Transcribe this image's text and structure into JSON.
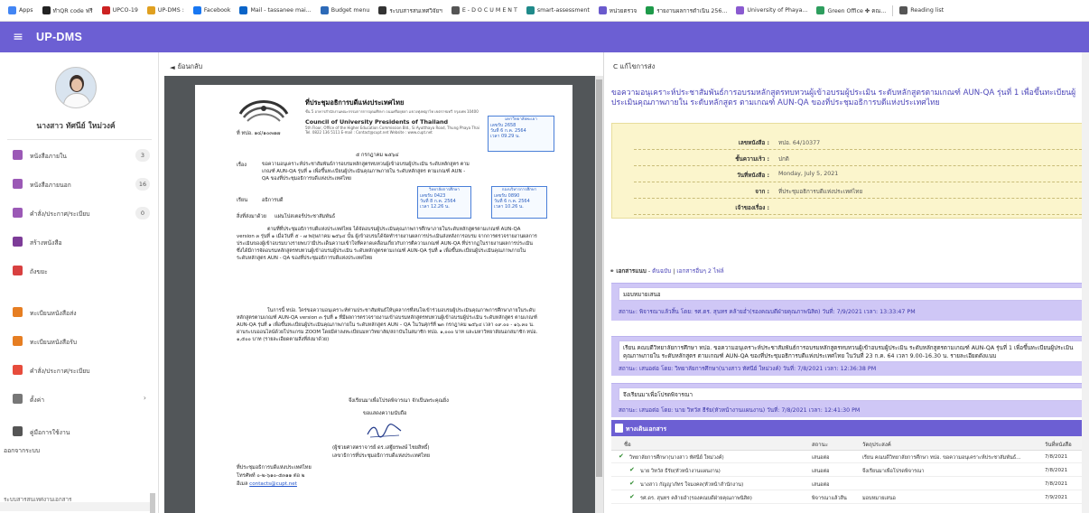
{
  "bookmarks": [
    {
      "label": "Apps",
      "color": "#4285f4"
    },
    {
      "label": "ทำQR code ฟรี",
      "color": "#222222"
    },
    {
      "label": "UPCO-19",
      "color": "#cc2222"
    },
    {
      "label": "UP-DMS : ",
      "color": "#e0a020"
    },
    {
      "label": "Facebook",
      "color": "#1877f2"
    },
    {
      "label": "Mail - tassanee mai...",
      "color": "#0a64c8"
    },
    {
      "label": "Budget menu",
      "color": "#2d6ab8"
    },
    {
      "label": "ระบบสารสนเทศวิจัยฯ",
      "color": "#333333"
    },
    {
      "label": "E - D O C U M E N T",
      "color": "#555555"
    },
    {
      "label": "smart-assessment",
      "color": "#1f8a8a"
    },
    {
      "label": "หน่วยตรวจ",
      "color": "#6a5acd"
    },
    {
      "label": "รายงานผลการดำเนิน 256...",
      "color": "#1e9a4a"
    },
    {
      "label": "University of Phaya...",
      "color": "#8a5ad0"
    },
    {
      "label": "Green Office ✤ คณ...",
      "color": "#2e9e5e"
    },
    {
      "label": "Reading list",
      "color": "#555555"
    }
  ],
  "app": {
    "title": "UP-DMS"
  },
  "user": {
    "name": "นางสาว ทัศนีย์ ใหม่วงค์"
  },
  "nav": [
    {
      "label": "หนังสือภายใน",
      "count": "3",
      "color": "#9b59b6"
    },
    {
      "label": "หนังสือภายนอก",
      "count": "16",
      "color": "#9b59b6"
    },
    {
      "label": "คำสั่ง/ประกาศ/ระเบียบ",
      "count": "0",
      "color": "#9b59b6"
    },
    {
      "label": "สร้างหนังสือ",
      "count": "",
      "color": "#7d3c98"
    },
    {
      "label": "ถังขยะ",
      "count": "",
      "color": "#d84040"
    },
    {
      "label": "ทะเบียนหนังสือส่ง",
      "count": "",
      "color": "#e67e22"
    },
    {
      "label": "ทะเบียนหนังสือรับ",
      "count": "",
      "color": "#e67e22"
    },
    {
      "label": "คำสั่ง/ประกาศ/ระเบียบ",
      "count": "",
      "color": "#e74c3c"
    },
    {
      "label": "ตั้งค่า",
      "count": "",
      "color": "#777777"
    },
    {
      "label": "คู่มือการใช้งาน",
      "count": "",
      "color": "#555555"
    },
    {
      "label": "ออกจากระบบ",
      "count": "",
      "color": ""
    }
  ],
  "sidebar_footer": "ระบบสารสนเทศงานเอกสาร",
  "doc_panel": {
    "back_label": "ย้อนกลับ"
  },
  "letter": {
    "org_th": "ที่ประชุมอธิการบดีแห่งประเทศไทย",
    "org_addr1": "ชั้น 5 อาคารสำนักงานคณะกรรมการการอุดมศึกษา ถนนศรีอยุธยา แขวงทุ่งพญาไท เขตราชเทวี กรุงเทพ 10400",
    "org_addr2": "Council of University Presidents of Thailand",
    "org_addr3": "5th Floor, Office of the Higher Education Commission Bld., Si Ayutthaya Road, Thung Phaya Thai",
    "org_addr4": "Tel. 0822 136 5111 E-mail : Contact@cupt.net  Website : www.cupt.net",
    "ref_no": "ที่ ทปอ. ๑๔/๑๐๓๗๗",
    "date": "๕ กรกฎาคม ๒๕๖๔",
    "subject_label": "เรื่อง",
    "subject": "ขอความอนุเคราะห์ประชาสัมพันธ์การอบรมหลักสูตรทบทวนผู้เข้าอบรมผู้ประเมิน ระดับหลักสูตร ตามเกณฑ์ AUN-QA รุ่นที่ ๑ เพื่อขึ้นทะเบียนผู้ประเมินคุณภาพภายใน ระดับหลักสูตร ตามเกณฑ์ AUN - QA ของที่ประชุมอธิการบดีแห่งประเทศไทย",
    "to_label": "เรียน",
    "to": "อธิการบดี",
    "enc_label": "สิ่งที่ส่งมาด้วย",
    "enc": "แผ่นโปสเตอร์ประชาสัมพันธ์",
    "para1": "ตามที่ที่ประชุมอธิการบดีแห่งประเทศไทย ได้จัดอบรมผู้ประเมินคุณภาพการศึกษาภายในระดับหลักสูตรตามเกณฑ์ AUN-QA version ๓ รุ่นที่ ๑ เมื่อวันที่ ๕ - ๗ พฤษภาคม ๒๕๖๔ นั้น ผู้เข้าอบรมได้จัดทำรายงานผลการประเมินส่งหลังการอบรม จากการตรวจรายงานผลการประเมินของผู้เข้าอบรมบางรายพบว่ามีประเด็นความเข้าใจที่คลาดเคลื่อนเกี่ยวกับการตีความเกณฑ์ AUN-QA ที่ปรากฏในรายงานผลการประเมิน ซึ่งได้มีการจัดอบรมหลักสูตรทบทวนผู้เข้าอบรมผู้ประเมิน ระดับหลักสูตรตามเกณฑ์ AUN-QA รุ่นที่ ๑ เพื่อขึ้นทะเบียนผู้ประเมินคุณภาพภายใน ระดับหลักสูตร AUN - QA ของที่ประชุมอธิการบดีแห่งประเทศไทย",
    "para2": "ในการนี้ ทปอ. ใคร่ขอความอนุเคราะห์ท่านประชาสัมพันธ์ให้บุคลากรที่สนใจเข้าร่วมอบรมผู้ประเมินคุณภาพการศึกษาภายในระดับหลักสูตรตามเกณฑ์ AUN-QA version ๓ รุ่นที่ ๑ ที่มีผลการตรวจรายงานเข้าอบรมหลักสูตรทบทวนผู้เข้าอบรมผู้ประเมิน ระดับหลักสูตร ตามเกณฑ์ AUN-QA รุ่นที่ ๑ เพื่อขึ้นทะเบียนผู้ประเมินคุณภาพภายใน ระดับหลักสูตร AUN – QA ในวันศุกร์ที่ ๒๓ กรกฎาคม ๒๕๖๔ เวลา ๐๙.๐๐ - ๑๖.๓๐ น. ผ่านระบบออนไลน์ด้วยโปรแกรม ZOOM โดยมีค่าลงทะเบียนมหาวิทยาลัย/สถาบันในสมาชิก ทปอ. ๑,๐๐๐ บาท และมหาวิทยาลัยนอกสมาชิก ทปอ. ๑,๕๐๐ บาท (รายละเอียดตามสิ่งที่ส่งมาด้วย)",
    "closing": "จึงเรียนมาเพื่อโปรดพิจารณา จักเป็นพระคุณยิ่ง",
    "regards": "ขอแสดงความนับถือ",
    "signer": "(ผู้ช่วยศาสตราจารย์ ดร.เสฐียรพงษ์ ไชยสิทธิ์)",
    "signer_title": "เลขาธิการที่ประชุมอธิการบดีแห่งประเทศไทย",
    "footer_org": "ที่ประชุมอธิการบดีแห่งประเทศไทย",
    "footer_tel": "โทรศัพท์ ๐-๒-๖๑๐-๕๓๑๑ ต่อ ๒",
    "footer_email_label": "อีเมล",
    "footer_email": "contacts@cupt.net"
  },
  "stamps": [
    {
      "h": "มหาวิทยาลัยพะเยา",
      "no": "เลขรับ 2658",
      "date": "วันที่ 6 ก.ค. 2564",
      "time": "เวลา 09.29 น."
    },
    {
      "h": "วิทยาลัยการศึกษา",
      "no": "เลขรับ 0423",
      "date": "วันที่ 8 ก.ค. 2564",
      "time": "เวลา 12.26 น."
    },
    {
      "h": "กองบริหารการศึกษา",
      "no": "เลขรับ 0890",
      "date": "วันที่ 6 ก.ค. 2564",
      "time": "เวลา 10.26 น."
    }
  ],
  "right_panel": {
    "back_label": "แก้ไขการส่ง",
    "title": "ขอความอนุเคราะห์ประชาสัมพันธ์การอบรมหลักสูตรทบทวนผู้เข้าอบรมผู้ประเมิน ระดับหลักสูตรตามเกณฑ์ AUN-QA รุ่นที่ 1 เพื่อขึ้นทะเบียนผู้ประเมินคุณภาพภายใน ระดับหลักสูตร ตามเกณฑ์ AUN-QA ของที่ประชุมอธิการบดีแห่งประเทศไทย",
    "info": [
      {
        "label": "เลขหนังสือ :",
        "value": "ทปอ. 64/10377"
      },
      {
        "label": "ชั้นความเร็ว :",
        "value": "ปกติ"
      },
      {
        "label": "วันที่หนังสือ :",
        "value": "Monday, July 5, 2021"
      },
      {
        "label": "จาก :",
        "value": "ที่ประชุมอธิการบดีแห่งประเทศไทย"
      },
      {
        "label": "เจ้าของเรื่อง :",
        "value": ""
      }
    ],
    "attachments": {
      "prefix": "เอกสารแนบ",
      "sep": "-",
      "all": "ต้นฉบับ",
      "pipe": "|",
      "files": "เอกสารอื่นๆ 2 ไฟล์"
    },
    "actions": [
      {
        "message": "มอบหมายเสนอ",
        "status": "สถานะ: พิจารณาแล้วสิ้น โดย: รศ.ดร. สุนทร คล้ายอ่ำ(รองคณบดีฝ่ายคุณภาพนิสิต)  วันที่: 7/9/2021  เวลา: 13:33:47 PM"
      },
      {
        "message": "เรียน คณบดีวิทยาลัยการศึกษา ทปอ. ขอความอนุเคราะห์ประชาสัมพันธ์การอบรมหลักสูตรทบทวนผู้เข้าอบรมผู้ประเมิน ระดับหลักสูตรตามเกณฑ์ AUN-QA รุ่นที่ 1 เพื่อขึ้นทะเบียนผู้ประเมินคุณภาพภายใน ระดับหลักสูตร ตามเกณฑ์ AUN-QA ของที่ประชุมอธิการบดีแห่งประเทศไทย ในวันที่ 23 ก.ค. 64 เวลา 9.00-16.30 น. รายละเอียดดังแนบ",
        "status": "สถานะ: เสนอต่อ  โดย: วิทยาลัยการศึกษา(นางสาว ทัศนีย์ ใหม่วงค์)  วันที่: 7/8/2021  เวลา: 12:36:38 PM"
      },
      {
        "message": "จึงเรียนมาเพื่อโปรดพิจารณา",
        "status": "สถานะ: เสนอต่อ  โดย: นาย วิทวัส ธีรัย(หัวหน้างานแผนงาน)  วันที่: 7/8/2021  เวลา: 12:41:30 PM"
      }
    ],
    "tracking": {
      "header": "ทางเดินเอกสาร",
      "columns": [
        "ชื่อ",
        "สถานะ",
        "วัตถุประสงค์",
        "วันที่หนังสือ"
      ],
      "rows": [
        {
          "name": "วิทยาลัยการศึกษา(นางสาว ทัศนีย์ ใหม่วงค์)",
          "status": "เสนอต่อ",
          "purpose": "เรียน คณบดีวิทยาลัยการศึกษา ทปอ. ขอความอนุเคราะห์ประชาสัมพันธ์...",
          "date": "7/8/2021"
        },
        {
          "name": "นาย วิทวัส ธีรัย(หัวหน้างานแผนงาน)",
          "status": "เสนอต่อ",
          "purpose": "จึงเรียนมาเพื่อโปรดพิจารณา",
          "date": "7/8/2021"
        },
        {
          "name": "นางสาว กัญญาภัทร ใจมงคล(หัวหน้าสำนักงาน)",
          "status": "เสนอต่อ",
          "purpose": "",
          "date": "7/8/2021"
        },
        {
          "name": "รศ.ดร. สุนทร คล้ายอ่ำ(รองคณบดีฝ่ายคุณภาพนิสิต)",
          "status": "พิจารณาแล้วสิ้น",
          "purpose": "มอบหมายเสนอ",
          "date": "7/9/2021"
        }
      ]
    }
  },
  "colors": {
    "brand": "#6c5fd3",
    "card": "#cfc7f6",
    "info_bg": "#fbf5cc"
  }
}
